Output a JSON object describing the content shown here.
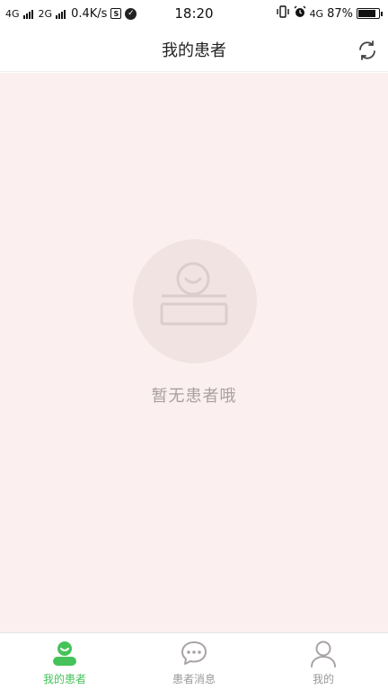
{
  "status_bar": {
    "net1": "4G",
    "net2": "2G",
    "speed": "0.4K/s",
    "sim_badge": "S",
    "time": "18:20",
    "net3": "4G",
    "battery": "87%",
    "battery_level": 0.87
  },
  "header": {
    "title": "我的患者"
  },
  "empty_state": {
    "message": "暂无患者哦"
  },
  "tabbar": {
    "tabs": [
      {
        "label": "我的患者",
        "icon": "patient-icon",
        "active": true
      },
      {
        "label": "患者消息",
        "icon": "chat-bubble-icon",
        "active": false
      },
      {
        "label": "我的",
        "icon": "person-icon",
        "active": false
      }
    ]
  },
  "colors": {
    "accent": "#45c35a",
    "background": "#fcefef",
    "illustration": "#f2e3e3",
    "muted": "#999999"
  }
}
